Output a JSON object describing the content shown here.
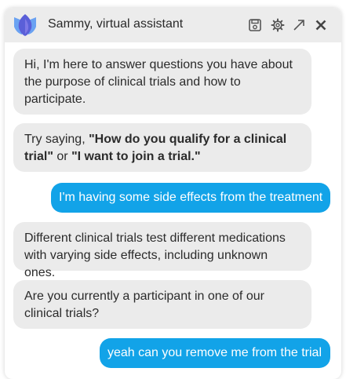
{
  "header": {
    "title": "Sammy, virtual assistant",
    "icons": [
      "logo-icon",
      "save-icon",
      "gear-icon",
      "expand-icon",
      "close-icon"
    ],
    "accent": "#5b6ee0"
  },
  "messages": [
    {
      "from": "bot",
      "text": "Hi, I'm here to answer questions you have about the purpose of clinical trials and how to participate."
    },
    {
      "from": "bot",
      "parts": [
        "Try saying, ",
        "\"How do you qualify for a clinical trial\"",
        " or ",
        "\"I want to join a trial.\""
      ]
    },
    {
      "from": "user",
      "text": "I'm having some side effects from the treatment"
    },
    {
      "from": "bot",
      "text": "Different clinical trials test different medications with varying side effects, including unknown ones."
    },
    {
      "from": "bot",
      "text": "Are you currently a participant in one of our clinical trials?"
    },
    {
      "from": "user",
      "text": "yeah can you remove me from the trial"
    }
  ],
  "colors": {
    "user_bubble": "#12a3e8",
    "bot_bubble": "#ebebeb",
    "header_bg": "#ececec"
  }
}
